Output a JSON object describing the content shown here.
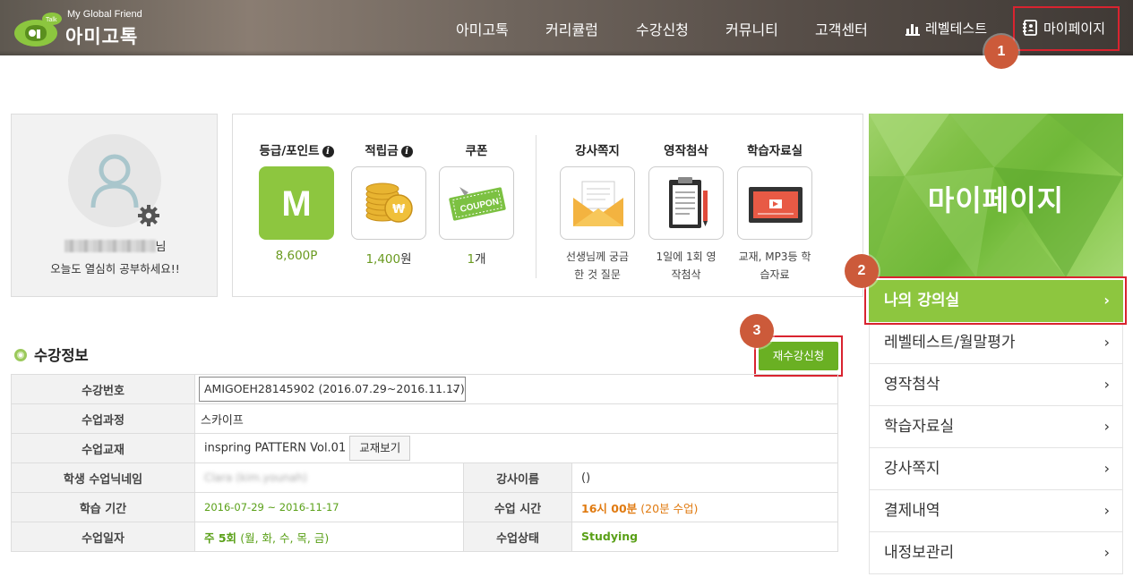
{
  "header": {
    "logo_sub": "My Global Friend",
    "logo_title": "아미고톡",
    "logo_badge_text": "Talk",
    "nav": [
      {
        "label": "아미고톡"
      },
      {
        "label": "커리큘럼"
      },
      {
        "label": "수강신청"
      },
      {
        "label": "커뮤니티"
      },
      {
        "label": "고객센터"
      },
      {
        "label": "레벨테스트",
        "icon": "bar-chart-icon"
      },
      {
        "label": "마이페이지",
        "icon": "contact-book-icon"
      }
    ]
  },
  "steps": [
    "1",
    "2",
    "3"
  ],
  "profile": {
    "name_suffix": "님",
    "greeting": "오늘도 열심히 공부하세요!!"
  },
  "stats": {
    "grade": {
      "label": "등급/포인트",
      "badge": "M",
      "value": "8,600",
      "unit": "P"
    },
    "savings": {
      "label": "적립금",
      "value": "1,400",
      "unit": "원"
    },
    "coupon": {
      "label": "쿠폰",
      "value": "1",
      "unit": "개",
      "image_text": "COUPON"
    },
    "teacher_note": {
      "label": "강사쪽지",
      "desc_line1": "선생님께 궁금",
      "desc_line2": "한 것 질문"
    },
    "correction": {
      "label": "영작첨삭",
      "desc_line1": "1일에 1회 영",
      "desc_line2": "작첨삭"
    },
    "materials": {
      "label": "학습자료실",
      "desc_line1": "교재, MP3등 학",
      "desc_line2": "습자료"
    }
  },
  "section": {
    "title": "수강정보",
    "re_register_button": "재수강신청"
  },
  "table": {
    "course_no_label": "수강번호",
    "course_no_value": "AMIGOEH28145902 (2016.07.29~2016.11.17)",
    "course_label": "수업과정",
    "course_value": "스카이프",
    "textbook_label": "수업교재",
    "textbook_value": "inspring PATTERN Vol.01",
    "textbook_button": "교재보기",
    "nickname_label": "학생 수업닉네임",
    "nickname_value": "Clara (kim.younah)",
    "teacher_label": "강사이름",
    "teacher_value": "()",
    "period_label": "학습 기간",
    "period_value": "2016-07-29 ~ 2016-11-17",
    "time_label": "수업 시간",
    "time_value": "16시 00분",
    "time_extra": "(20분 수업)",
    "days_label": "수업일자",
    "days_value_bold": "주 5회",
    "days_value": "(월, 화, 수, 목, 금)",
    "status_label": "수업상태",
    "status_value": "Studying"
  },
  "sidebar": {
    "banner_title": "마이페이지",
    "items": [
      {
        "label": "나의 강의실",
        "active": true
      },
      {
        "label": "레벨테스트/월말평가"
      },
      {
        "label": "영작첨삭"
      },
      {
        "label": "학습자료실"
      },
      {
        "label": "강사쪽지"
      },
      {
        "label": "결제내역"
      },
      {
        "label": "내정보관리"
      }
    ],
    "arrow": "›"
  },
  "colors": {
    "accent_green": "#8dc63f",
    "button_green": "#6ab023",
    "highlight_red": "#d9232f",
    "step_badge": "#cc5a3a",
    "orange_text": "#e07a10"
  }
}
